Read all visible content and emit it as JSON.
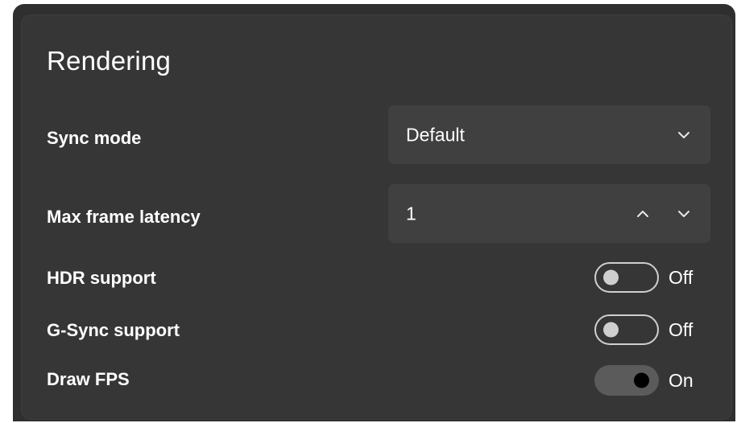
{
  "section": {
    "title": "Rendering"
  },
  "settings": {
    "sync_mode": {
      "label": "Sync mode",
      "value": "Default",
      "icon": "chevron-down-icon"
    },
    "max_frame_latency": {
      "label": "Max frame latency",
      "value": "1",
      "icons": [
        "chevron-up-icon",
        "chevron-down-icon"
      ]
    },
    "hdr_support": {
      "label": "HDR support",
      "state": "Off",
      "on": false
    },
    "gsync_support": {
      "label": "G-Sync support",
      "state": "Off",
      "on": false
    },
    "draw_fps": {
      "label": "Draw FPS",
      "state": "On",
      "on": true
    }
  },
  "colors": {
    "background": "#2f2f2f",
    "card": "#363636",
    "field": "#404040",
    "text": "#ffffff",
    "toggle_off_border": "#cfcfcf",
    "toggle_on_track": "#5b5b5b"
  }
}
